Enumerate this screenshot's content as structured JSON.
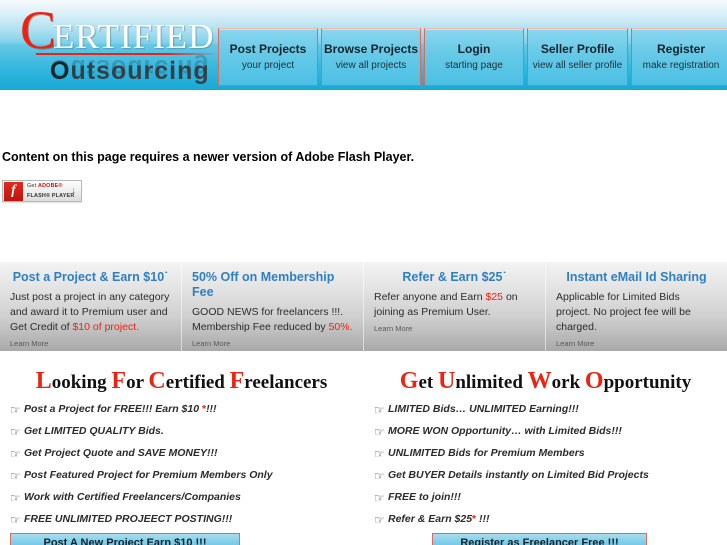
{
  "header": {
    "logo": {
      "drop_cap": "C",
      "word1_rest": "ERTIFIED",
      "word2_first": "O",
      "word2_rest": "utsourcing",
      "reflection_text": "Outsourcing"
    },
    "nav": [
      {
        "title": "Post Projects",
        "subtitle": "your project"
      },
      {
        "title": "Browse Projects",
        "subtitle": "view all projects"
      },
      {
        "title": "Login",
        "subtitle": "starting page"
      },
      {
        "title": "Seller Profile",
        "subtitle": "view all seller profile"
      },
      {
        "title": "Register",
        "subtitle": "make registration"
      }
    ]
  },
  "flash": {
    "notice": "Content on this page requires a newer version of Adobe Flash Player.",
    "badge": {
      "icon_glyph": "f",
      "line1_pre": "Get ",
      "line1_brand": "ADOBE®",
      "line2": "FLASH® PLAYER",
      "arrow": "↓"
    }
  },
  "promos": [
    {
      "title": "Post a Project & Earn $10˙",
      "body_pre": "Just post a project in any category and award it to Premium user and Get Credit of ",
      "body_red": "$10 of project.",
      "body_post": "",
      "learn_more": "Learn More",
      "align": "center"
    },
    {
      "title": "50% Off on Membership Fee",
      "body_pre": "GOOD NEWS for freelancers !!!. Membership Fee reduced by ",
      "body_red": "50%.",
      "body_post": "",
      "learn_more": "Learn More",
      "align": "left"
    },
    {
      "title": "Refer & Earn $25˙",
      "body_pre": "Refer anyone and Earn ",
      "body_red": "$25",
      "body_post": " on joining as Premium User.",
      "learn_more": "Learn More",
      "align": "center"
    },
    {
      "title": "Instant eMail Id Sharing",
      "body_pre": "Applicable for Limited Bids project. No project fee will be charged.",
      "body_red": "",
      "body_post": "",
      "learn_more": "Learn More",
      "align": "center"
    }
  ],
  "columns": [
    {
      "title_parts": [
        {
          "cap": "L",
          "rest": "ooking"
        },
        {
          "cap": "F",
          "rest": "or"
        },
        {
          "cap": "C",
          "rest": "ertified"
        },
        {
          "cap": "F",
          "rest": "reelancers"
        }
      ],
      "bullet_icon": "pointing-hand",
      "items": [
        {
          "text": "Post a Project for FREE!!! Earn $10 ",
          "suffix_red": "*",
          "suffix": "!!!"
        },
        {
          "text": "Get LIMITED QUALITY Bids.",
          "suffix_red": "",
          "suffix": ""
        },
        {
          "text": "Get Project Quote and SAVE MONEY!!!",
          "suffix_red": "",
          "suffix": ""
        },
        {
          "text": "Post Featured Project for Premium Members Only",
          "suffix_red": "",
          "suffix": ""
        },
        {
          "text": "Work with Certified Freelancers/Companies",
          "suffix_red": "",
          "suffix": ""
        },
        {
          "text": "FREE UNLIMITED PROJEECT POSTING!!!",
          "suffix_red": "",
          "suffix": ""
        }
      ],
      "cta": "Post A New Project Earn $10 !!!"
    },
    {
      "title_parts": [
        {
          "cap": "G",
          "rest": "et"
        },
        {
          "cap": "U",
          "rest": "nlimited"
        },
        {
          "cap": "W",
          "rest": "ork"
        },
        {
          "cap": "O",
          "rest": "pportunity"
        }
      ],
      "bullet_icon": "pointing-hand",
      "items": [
        {
          "text": "LIMITED Bids… UNLIMITED Earning!!!",
          "suffix_red": "",
          "suffix": ""
        },
        {
          "text": "MORE WON Opportunity… with Limited Bids!!!",
          "suffix_red": "",
          "suffix": ""
        },
        {
          "text": "UNLIMITED Bids for Premium Members",
          "suffix_red": "",
          "suffix": ""
        },
        {
          "text": "Get BUYER Details instantly on Limited Bid Projects",
          "suffix_red": "",
          "suffix": ""
        },
        {
          "text": "FREE to join!!!",
          "suffix_red": "",
          "suffix": ""
        },
        {
          "text": "Refer & Earn $25",
          "suffix_red": "*",
          "suffix": " !!!"
        }
      ],
      "cta": "Register as Freelancer Free !!!"
    }
  ],
  "colors": {
    "header_cyan": "#2fb6de",
    "logo_red": "#ee2211",
    "promo_title_blue": "#2f7fc4",
    "accent_red": "#ee2211",
    "nav_border": "#e06a5a"
  }
}
